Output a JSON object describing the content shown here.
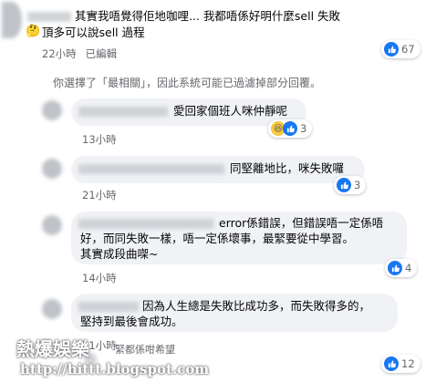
{
  "comments": [
    {
      "line1": "其實我唔覺得佢地咖哩... 我都唔係好明什麼sell 失敗",
      "line2": "頂多可以說sell 過程",
      "emoji": "🤔",
      "time": "22小時",
      "edited": "已編輯",
      "reaction_count": "67"
    },
    {
      "line1": "愛回家個班人咪仲靜呢",
      "time": "13小時",
      "reaction_count": "3"
    },
    {
      "line1": "同堅離地比，咪失敗囉",
      "time": "21小時",
      "reaction_count": "3"
    },
    {
      "line1": "error係錯誤，但錯誤唔一定係唔",
      "line2": "好，而同失敗一樣，唔一定係壞事，最緊要從中學習。",
      "line3": "其實成段曲㗎~",
      "time": "14小時",
      "reaction_count": "4"
    },
    {
      "line1": "因為人生總是失敗比成功多，而失敗得多的，",
      "line2": "堅持到最後會成功。",
      "time": "21小時",
      "partial": "緊都係咁希望",
      "reaction_count": "12"
    }
  ],
  "filter_notice": "你選擇了「最相關」，因此系統可能已過濾掉部分回覆。",
  "watermark": {
    "title": "熱爆娛樂",
    "url": "http://hittt.blogspot.com"
  },
  "colors": {
    "like_blue": "#1877f2",
    "bubble_gray": "#f0f2f5",
    "meta_gray": "#65676b"
  },
  "icons": [
    "like-icon",
    "haha-icon",
    "thinking-emoji"
  ]
}
